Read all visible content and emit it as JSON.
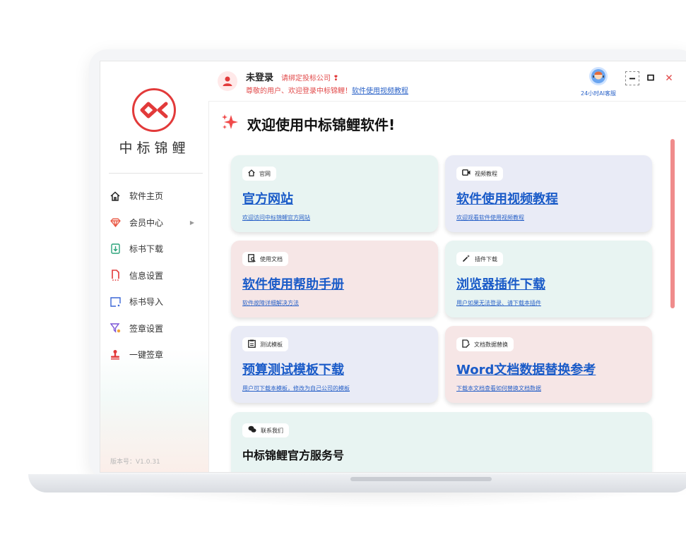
{
  "sidebar": {
    "brand": "中标锦鲤",
    "items": [
      {
        "label": "软件主页",
        "icon": "home-icon"
      },
      {
        "label": "会员中心",
        "icon": "diamond-icon"
      },
      {
        "label": "标书下载",
        "icon": "download-doc-icon"
      },
      {
        "label": "信息设置",
        "icon": "info-doc-icon"
      },
      {
        "label": "标书导入",
        "icon": "import-icon"
      },
      {
        "label": "签章设置",
        "icon": "seal-settings-icon"
      },
      {
        "label": "一键签章",
        "icon": "stamp-icon"
      }
    ],
    "version": "版本号：V1.0.31"
  },
  "header": {
    "user_name": "未登录",
    "bind_company": "请绑定投标公司",
    "welcome_text": "尊敬的用户、欢迎登录中标锦鲤！",
    "video_link": "软件使用视频教程",
    "ai_service": "24小时AI客服"
  },
  "main": {
    "title": "欢迎使用中标锦鲤软件!",
    "cards": [
      {
        "tag": "官网",
        "title": "官方网站",
        "desc": "欢迎访问中标锦鲤官方网站"
      },
      {
        "tag": "视频教程",
        "title": "软件使用视频教程",
        "desc": "欢迎观看软件使用视频教程"
      },
      {
        "tag": "使用文档",
        "title": "软件使用帮助手册",
        "desc": "软件故障详细解决方法"
      },
      {
        "tag": "插件下载",
        "title": "浏览器插件下载",
        "desc": "用户如果无法登录、请下载本插件"
      },
      {
        "tag": "测试模板",
        "title": "预算测试模板下载",
        "desc": "用户可下载本模板，修改为自己公司的模板"
      },
      {
        "tag": "文档数据替换",
        "title": "Word文档数据替换参考",
        "desc": "下载本文档查看如何替换文档数据"
      }
    ],
    "contact": {
      "tag": "联系我们",
      "title": "中标锦鲤官方服务号"
    }
  },
  "colors": {
    "brand_red": "#e23a3a",
    "link_blue": "#1a5bc8",
    "scroll": "#f08c8c"
  }
}
